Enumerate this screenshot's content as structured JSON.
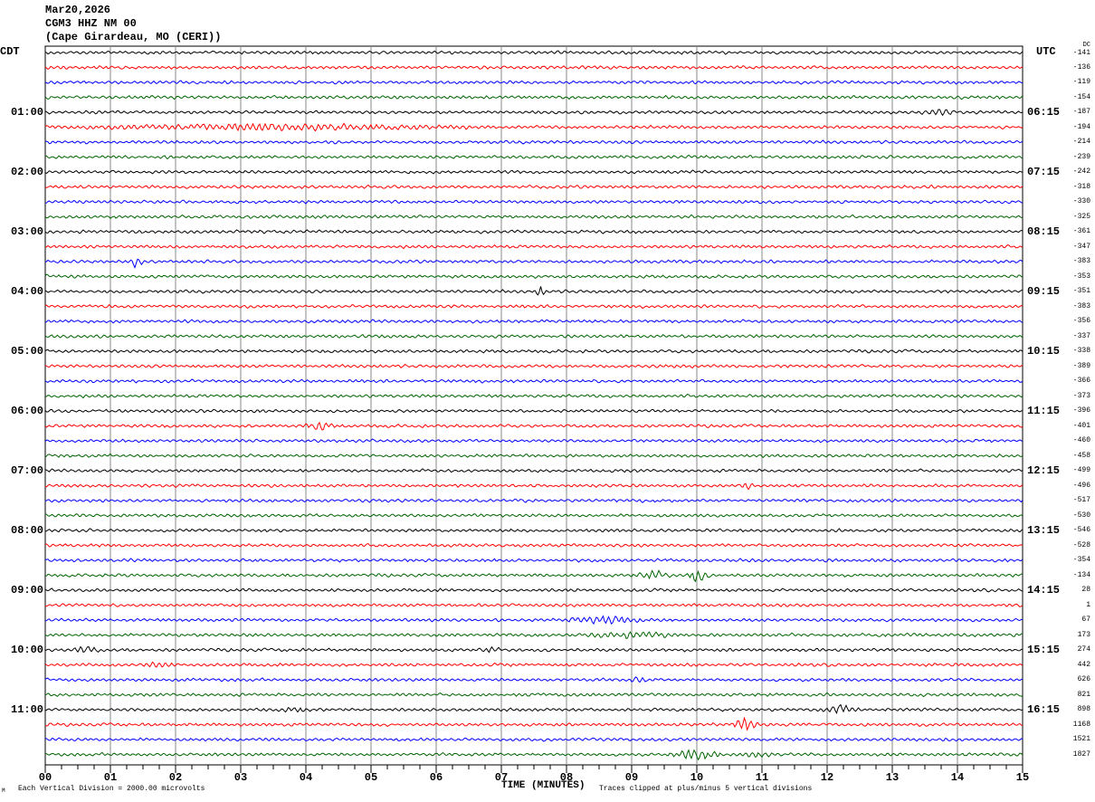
{
  "header": {
    "date": "Mar20,2026",
    "station": "CGM3 HHZ NM 00",
    "location": "(Cape Girardeau, MO (CERI))"
  },
  "left_zone": "CDT",
  "right_zone": "UTC",
  "dc_label": "DC",
  "footer": {
    "scale": "Each Vertical Division = 2000.00 microvolts",
    "xlabel": "TIME (MINUTES)",
    "clip": "Traces clipped at plus/minus 5 vertical divisions",
    "mark": "M"
  },
  "chart_data": {
    "type": "line",
    "title": "Mar20,2026 CGM3 HHZ NM 00 (Cape Girardeau, MO (CERI))",
    "xlabel": "TIME (MINUTES)",
    "xlim": [
      0,
      15
    ],
    "xticks": [
      "00",
      "01",
      "02",
      "03",
      "04",
      "05",
      "06",
      "07",
      "08",
      "09",
      "10",
      "11",
      "12",
      "13",
      "14",
      "15"
    ],
    "grid": true,
    "trace_colors": [
      "#000000",
      "#ff0000",
      "#0000ff",
      "#006400"
    ],
    "left_hour_labels": [
      "01:00",
      "02:00",
      "03:00",
      "04:00",
      "05:00",
      "06:00",
      "07:00",
      "08:00",
      "09:00",
      "10:00",
      "11:00"
    ],
    "right_hour_labels": [
      "06:15",
      "07:15",
      "08:15",
      "09:15",
      "10:15",
      "11:15",
      "12:15",
      "13:15",
      "14:15",
      "15:15",
      "16:15"
    ],
    "dc_offsets": [
      "-141",
      "-136",
      "-119",
      "-154",
      "-187",
      "-194",
      "-214",
      "-239",
      "-242",
      "-318",
      "-330",
      "-325",
      "-361",
      "-347",
      "-383",
      "-353",
      "-351",
      "-383",
      "-356",
      "-337",
      "-338",
      "-389",
      "-366",
      "-373",
      "-396",
      "-401",
      "-460",
      "-458",
      "-499",
      "-496",
      "-517",
      "-530",
      "-546",
      "-528",
      "-354",
      "-134",
      "28",
      "1",
      "67",
      "173",
      "274",
      "442",
      "626",
      "821",
      "898",
      "1168",
      "1521",
      "1827"
    ],
    "events": [
      {
        "trace": 4,
        "minute": 13.7,
        "width": 0.6,
        "amp": 2
      },
      {
        "trace": 5,
        "minute": 3.5,
        "width": 7,
        "amp": 2
      },
      {
        "trace": 14,
        "minute": 1.4,
        "width": 0.1,
        "amp": 5
      },
      {
        "trace": 16,
        "minute": 7.6,
        "width": 0.1,
        "amp": 4
      },
      {
        "trace": 25,
        "minute": 4.2,
        "width": 0.4,
        "amp": 3
      },
      {
        "trace": 29,
        "minute": 10.8,
        "width": 0.1,
        "amp": 4
      },
      {
        "trace": 35,
        "minute": 9.3,
        "width": 0.6,
        "amp": 3
      },
      {
        "trace": 35,
        "minute": 10.0,
        "width": 0.3,
        "amp": 5
      },
      {
        "trace": 38,
        "minute": 8.6,
        "width": 1.4,
        "amp": 2.5
      },
      {
        "trace": 39,
        "minute": 9.0,
        "width": 1.5,
        "amp": 2
      },
      {
        "trace": 40,
        "minute": 0.6,
        "width": 0.5,
        "amp": 2
      },
      {
        "trace": 40,
        "minute": 6.8,
        "width": 0.3,
        "amp": 2
      },
      {
        "trace": 41,
        "minute": 1.7,
        "width": 0.5,
        "amp": 2
      },
      {
        "trace": 42,
        "minute": 9.1,
        "width": 0.2,
        "amp": 2
      },
      {
        "trace": 45,
        "minute": 10.8,
        "width": 0.3,
        "amp": 3
      },
      {
        "trace": 47,
        "minute": 10.9,
        "width": 0.5,
        "amp": 2
      },
      {
        "trace": 48,
        "minute": 3.8,
        "width": 0.4,
        "amp": 2
      },
      {
        "trace": 48,
        "minute": 12.2,
        "width": 0.6,
        "amp": 3
      },
      {
        "trace": 49,
        "minute": 10.7,
        "width": 0.2,
        "amp": 4
      },
      {
        "trace": 51,
        "minute": 10.0,
        "width": 0.8,
        "amp": 4
      }
    ]
  }
}
